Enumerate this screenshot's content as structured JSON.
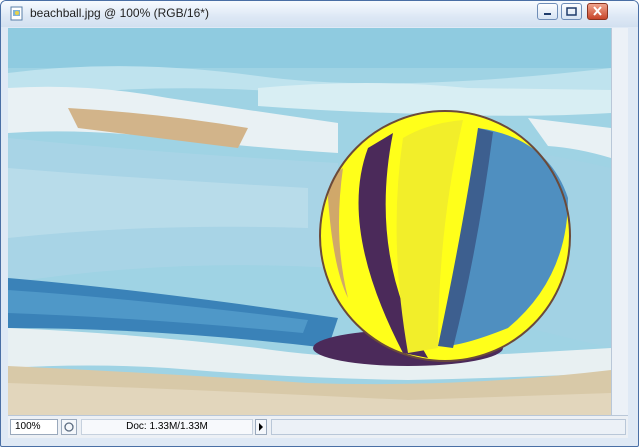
{
  "window": {
    "title": "beachball.jpg @ 100% (RGB/16*)",
    "icons": {
      "document": "document-icon",
      "minimize": "minimize-icon",
      "restore": "restore-icon",
      "close": "close-icon"
    }
  },
  "canvas": {
    "image_description_icon": "photo-canvas",
    "colors": {
      "sky_water": "#9fd3e4",
      "foam": "#e8f0f2",
      "sand": "#d8c9a8",
      "ball_yellow": "#ffff1a",
      "ball_blue": "#4f8fc0",
      "ball_shadow": "#4b2a5a"
    }
  },
  "status": {
    "zoom": "100%",
    "doc_info": "Doc: 1.33M/1.33M"
  }
}
